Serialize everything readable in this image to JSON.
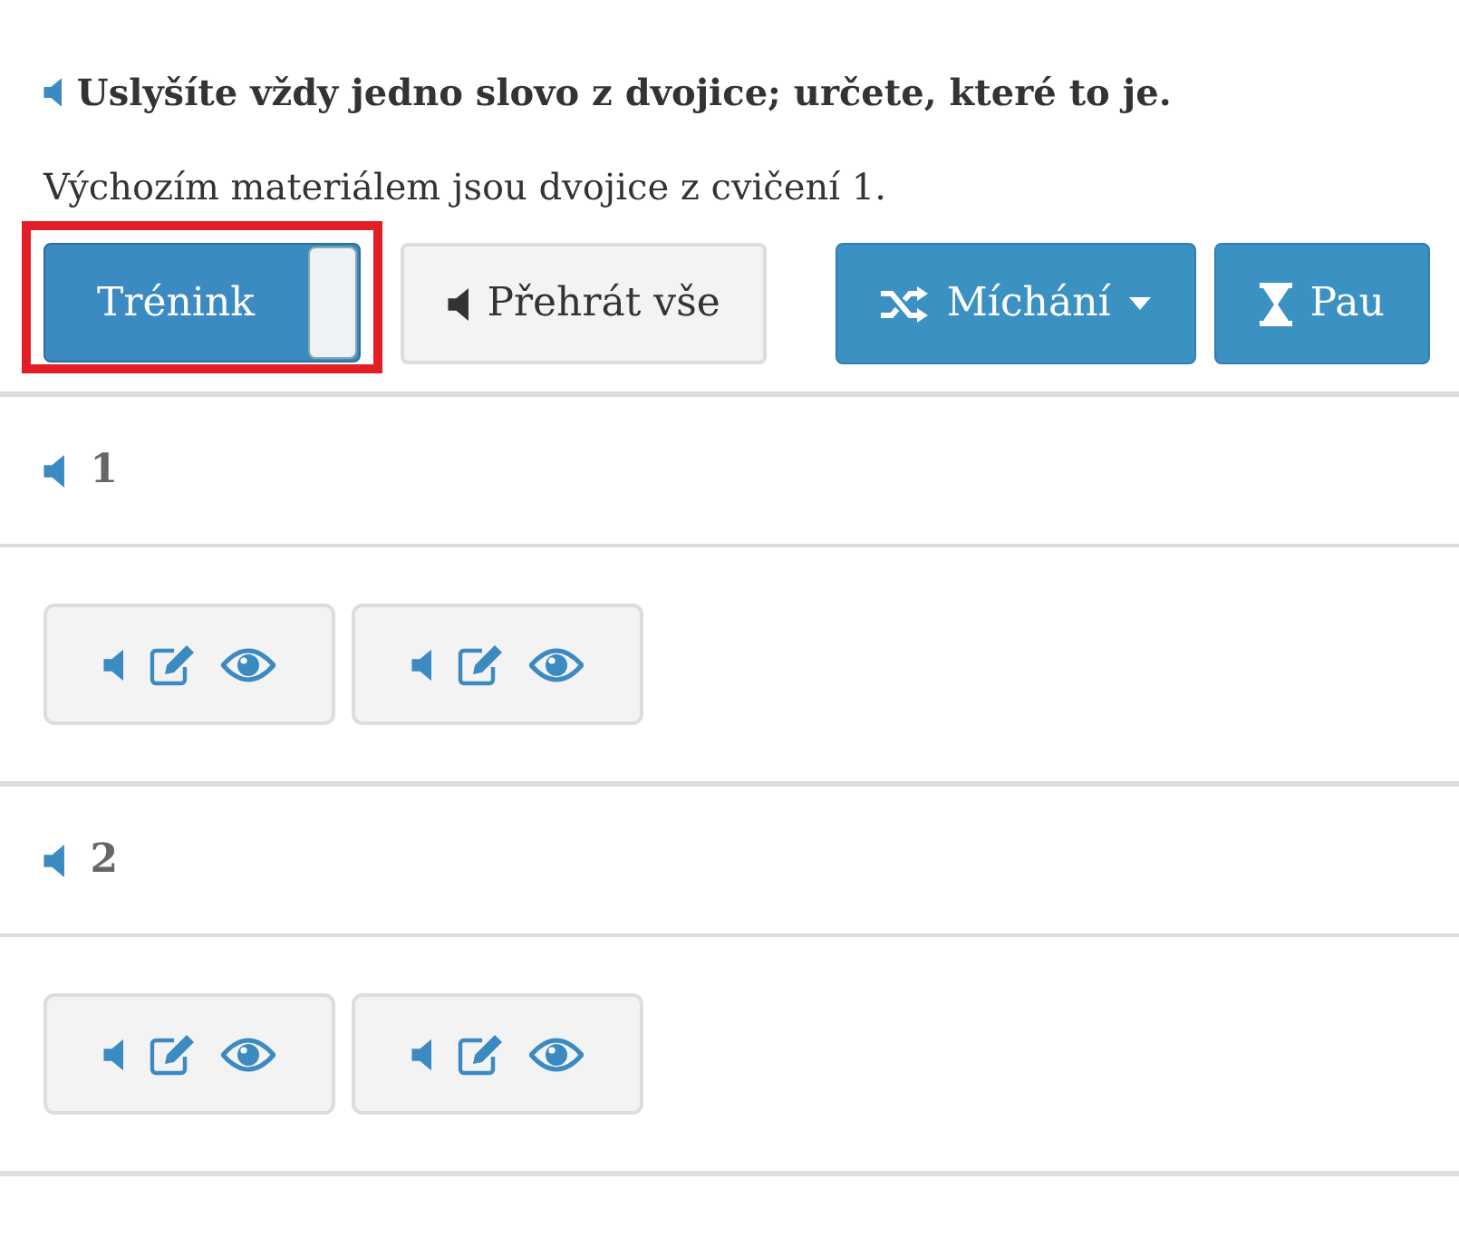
{
  "instruction": "Uslyšíte vždy jedno slovo z dvojice; určete, které to je.",
  "source_note": "Výchozím materiálem jsou dvojice z cvičení 1.",
  "toolbar": {
    "training_toggle": {
      "label": "Trénink",
      "on": true,
      "highlighted": true
    },
    "buttons": [
      {
        "kind": "play",
        "label": "Přehrát vše"
      },
      {
        "kind": "shuffle",
        "label": "Míchání"
      },
      {
        "kind": "pause",
        "label": "Pau"
      }
    ]
  },
  "items": [
    {
      "number": "1",
      "answers": [
        {
          "kind": "answer"
        },
        {
          "kind": "answer"
        }
      ]
    },
    {
      "number": "2",
      "answers": [
        {
          "kind": "answer"
        },
        {
          "kind": "answer"
        }
      ]
    }
  ]
}
